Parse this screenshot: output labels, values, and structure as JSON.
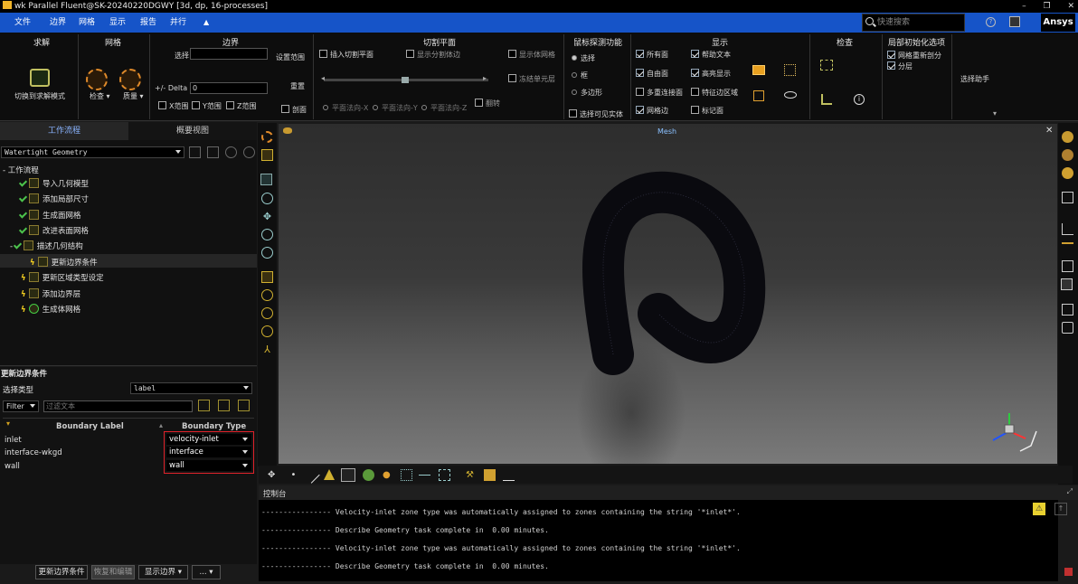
{
  "window": {
    "title": "wk Parallel Fluent@SK-20240220DGWY  [3d, dp, 16-processes]",
    "controls": [
      "–",
      "❐",
      "✕"
    ]
  },
  "menu": [
    "文件",
    "边界",
    "网格",
    "显示",
    "报告",
    "并行",
    "▲"
  ],
  "search": {
    "placeholder": "快速搜索"
  },
  "brand": "Ansys",
  "ribbon": {
    "groups": {
      "solve": {
        "title": "求解",
        "button": "切换到求解模式"
      },
      "mesh": {
        "title": "网格",
        "check": "检查",
        "quality": "质量"
      },
      "boundary": {
        "title": "边界",
        "select_label": "选择",
        "delta_label": "+/- Delta",
        "delta_value": "0",
        "set_range": "设置范围",
        "reset": "重置",
        "x_range": "X范围",
        "y_range": "Y范围",
        "z_range": "Z范围",
        "cut": "剖面"
      },
      "cutplane": {
        "title": "切割平面",
        "insert": "插入切割平面",
        "show_edges": "显示分割体边",
        "show_mesh": "显示体网格",
        "freeze": "冻结单元层",
        "flip": "翻转",
        "normals": [
          "平面法向-X",
          "平面法向-Y",
          "平面法向-Z"
        ]
      },
      "probe": {
        "title": "鼠标探测功能",
        "options": [
          "选择",
          "框",
          "多边形"
        ],
        "selectable": "选择可见实体"
      },
      "display": {
        "title": "显示",
        "items": [
          {
            "label": "所有面",
            "checked": true
          },
          {
            "label": "帮助文本",
            "checked": true
          },
          {
            "label": "自由面",
            "checked": true
          },
          {
            "label": "高亮显示",
            "checked": true
          },
          {
            "label": "多重连接面",
            "checked": false
          },
          {
            "label": "特征边区域",
            "checked": false
          },
          {
            "label": "网格边",
            "checked": true
          },
          {
            "label": "标记面",
            "checked": false
          }
        ]
      },
      "inspect": {
        "title": "检查"
      },
      "local_init": {
        "title": "局部初始化选项",
        "items": [
          {
            "label": "网格重新剖分",
            "checked": true
          },
          {
            "label": "分层",
            "checked": true
          }
        ]
      },
      "assistant": {
        "title": "选择助手"
      }
    }
  },
  "left_panel": {
    "tabs": [
      "工作流程",
      "概要视图"
    ],
    "workflow_type": "Watertight Geometry",
    "tree_root": "工作流程",
    "tree": [
      {
        "label": "导入几何模型",
        "status": "done"
      },
      {
        "label": "添加局部尺寸",
        "status": "done"
      },
      {
        "label": "生成面网格",
        "status": "done"
      },
      {
        "label": "改进表面网格",
        "status": "done"
      },
      {
        "label": "描述几何结构",
        "status": "done"
      },
      {
        "label": "更新边界条件",
        "status": "pending"
      },
      {
        "label": "更新区域类型设定",
        "status": "pending"
      },
      {
        "label": "添加边界层",
        "status": "pending"
      },
      {
        "label": "生成体网格",
        "status": "pending"
      }
    ]
  },
  "task_panel": {
    "title": "更新边界条件",
    "select_type_label": "选择类型",
    "select_type_value": "label",
    "filter_label": "Filter",
    "filter_placeholder": "过滤文本",
    "columns": [
      "Boundary Label",
      "Boundary Type"
    ],
    "rows": [
      {
        "label": "inlet",
        "type": "velocity-inlet"
      },
      {
        "label": "interface-wkgd",
        "type": "interface"
      },
      {
        "label": "wall",
        "type": "wall"
      }
    ],
    "buttons": [
      "更新边界条件",
      "恢复和编辑",
      "显示边界",
      "..."
    ]
  },
  "viewport": {
    "title": "Mesh"
  },
  "console": {
    "title": "控制台",
    "lines": [
      "---------------- Velocity-inlet zone type was automatically assigned to zones containing the string '*inlet*'.",
      "---------------- Describe Geometry task complete in  0.00 minutes.",
      "---------------- Velocity-inlet zone type was automatically assigned to zones containing the string '*inlet*'.",
      "---------------- Describe Geometry task complete in  0.00 minutes."
    ]
  },
  "colors": {
    "menubar": "#1654c8",
    "accent_check": "#4cc34c",
    "highlight_box": "#e0222a",
    "pending": "#f5d020"
  }
}
